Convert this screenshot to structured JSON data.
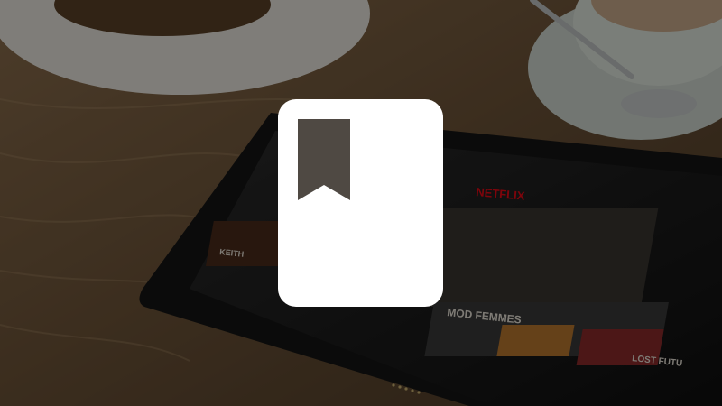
{
  "tablet": {
    "brand_logo": "NETFLIX",
    "poster_titles": [
      "KEITH",
      "MOD FEMMES",
      "LOST FUTU"
    ]
  },
  "overlay_icon": "bookmark-document-icon",
  "colors": {
    "table_wood": "#6b5237",
    "tablet_body": "#1a1a1a",
    "netflix_red": "#e50914",
    "icon_fill": "#ffffff",
    "icon_flag": "#4f4943"
  }
}
